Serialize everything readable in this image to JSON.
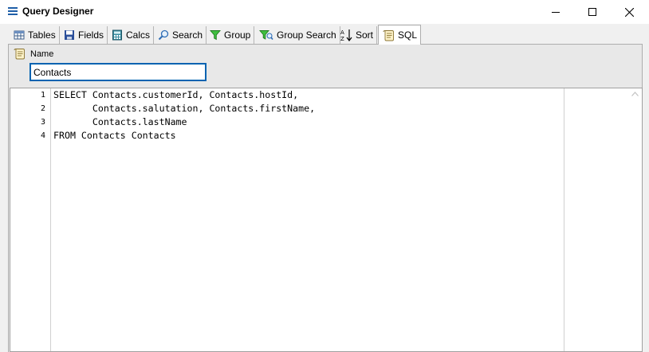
{
  "window": {
    "title": "Query Designer"
  },
  "tabs": [
    {
      "label": "Tables",
      "icon": "table-icon"
    },
    {
      "label": "Fields",
      "icon": "floppy-disk-icon"
    },
    {
      "label": "Calcs",
      "icon": "calculator-icon"
    },
    {
      "label": "Search",
      "icon": "magnifier-icon"
    },
    {
      "label": "Group",
      "icon": "funnel-icon"
    },
    {
      "label": "Group Search",
      "icon": "funnel-magnifier-icon"
    },
    {
      "label": "Sort",
      "icon": "sort-az-icon"
    },
    {
      "label": "SQL",
      "icon": "sql-script-icon",
      "active": true
    }
  ],
  "sql_tab": {
    "name_label": "Name",
    "name_value": "Contacts",
    "line_numbers": [
      "1",
      "2",
      "3",
      "4"
    ],
    "code_lines": [
      "SELECT Contacts.customerId, Contacts.hostId,",
      "       Contacts.salutation, Contacts.firstName,",
      "       Contacts.lastName",
      "FROM Contacts Contacts"
    ]
  }
}
